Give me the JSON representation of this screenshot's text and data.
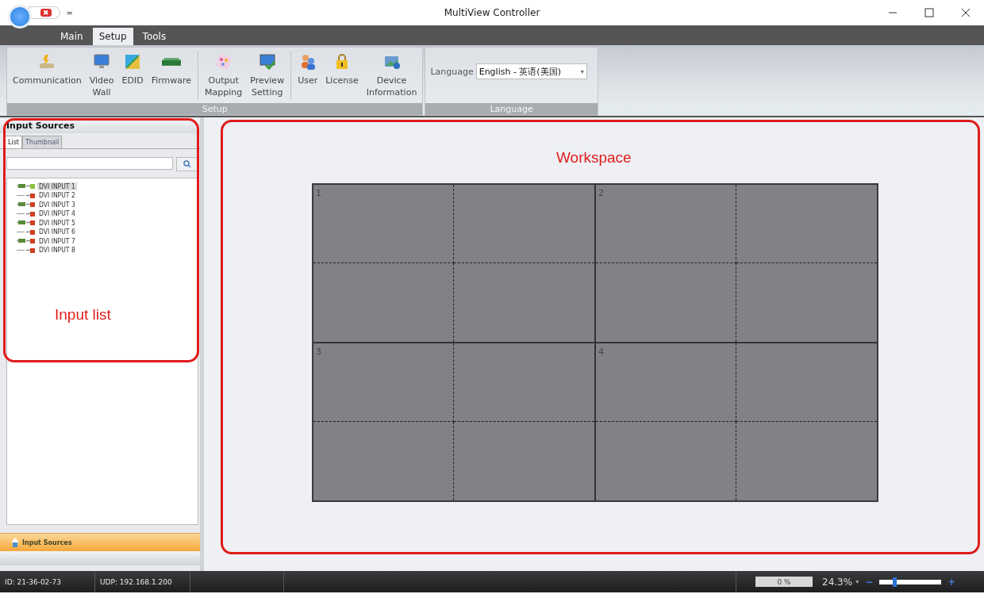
{
  "window": {
    "title": "MultiView Controller"
  },
  "quick_access": {
    "close_label": "✖",
    "more_label": "="
  },
  "tabs": [
    {
      "label": "Main",
      "selected": false
    },
    {
      "label": "Setup",
      "selected": true
    },
    {
      "label": "Tools",
      "selected": false
    }
  ],
  "ribbon_groups": [
    {
      "label": "Setup",
      "buttons": [
        {
          "kind": "button",
          "label": "Communication"
        },
        {
          "kind": "button",
          "label": "Video\nWall"
        },
        {
          "kind": "button",
          "label": "EDID"
        },
        {
          "kind": "button",
          "label": "Firmware"
        },
        {
          "kind": "sep"
        },
        {
          "kind": "button",
          "label": "Output\nMapping"
        },
        {
          "kind": "button",
          "label": "Preview\nSetting"
        },
        {
          "kind": "sep"
        },
        {
          "kind": "button",
          "label": "User"
        },
        {
          "kind": "button",
          "label": "License"
        },
        {
          "kind": "button",
          "label": "Device\nInformation"
        }
      ]
    },
    {
      "label": "Language",
      "language": {
        "label": "Language",
        "value": "English - 英语(美国)",
        "caret": "▾"
      }
    }
  ],
  "input_panel": {
    "title": "Input Sources",
    "tabs": [
      {
        "label": "List",
        "selected": true
      },
      {
        "label": "Thumbnail",
        "selected": false
      }
    ],
    "items": [
      {
        "label": "DVI INPUT 1",
        "connected": true,
        "selected": true
      },
      {
        "label": "DVI INPUT 2",
        "connected": false,
        "selected": false
      },
      {
        "label": "DVI INPUT 3",
        "connected": true,
        "selected": false
      },
      {
        "label": "DVI INPUT 4",
        "connected": false,
        "selected": false
      },
      {
        "label": "DVI INPUT 5",
        "connected": true,
        "selected": false
      },
      {
        "label": "DVI INPUT 6",
        "connected": false,
        "selected": false
      },
      {
        "label": "DVI INPUT 7",
        "connected": true,
        "selected": false
      },
      {
        "label": "DVI INPUT 8",
        "connected": false,
        "selected": false
      }
    ],
    "annotation": "Input list",
    "nav_button": "Input Sources"
  },
  "workspace": {
    "annotation": "Workspace",
    "screens": [
      "1",
      "2",
      "3",
      "4"
    ]
  },
  "status_bar": {
    "id": "ID: 21-36-02-73",
    "udp": "UDP: 192.168.1.200",
    "progress": {
      "label": "0 %",
      "level": 0
    },
    "zoom": {
      "label": "24.3%",
      "caret": "▾",
      "minus": "−",
      "plus": "+",
      "level": 0.24
    }
  }
}
